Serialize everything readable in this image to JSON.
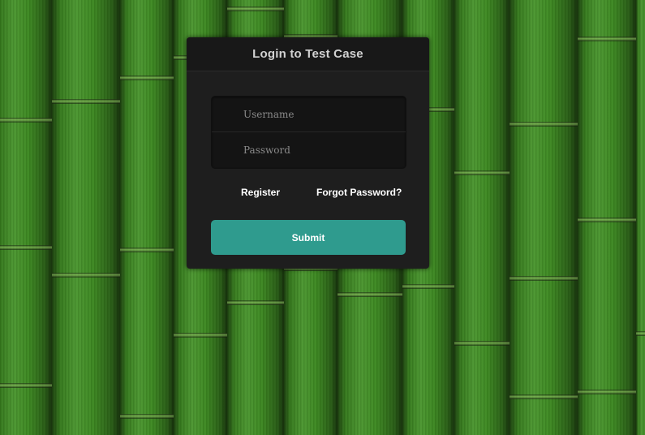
{
  "login": {
    "title": "Login to Test Case",
    "username_placeholder": "Username",
    "password_placeholder": "Password",
    "register_label": "Register",
    "forgot_label": "Forgot Password?",
    "submit_label": "Submit"
  },
  "colors": {
    "panel_bg": "#1e1e1e",
    "header_bg": "#181818",
    "submit_bg": "#2f9b8e",
    "background": "#3f8f22"
  }
}
